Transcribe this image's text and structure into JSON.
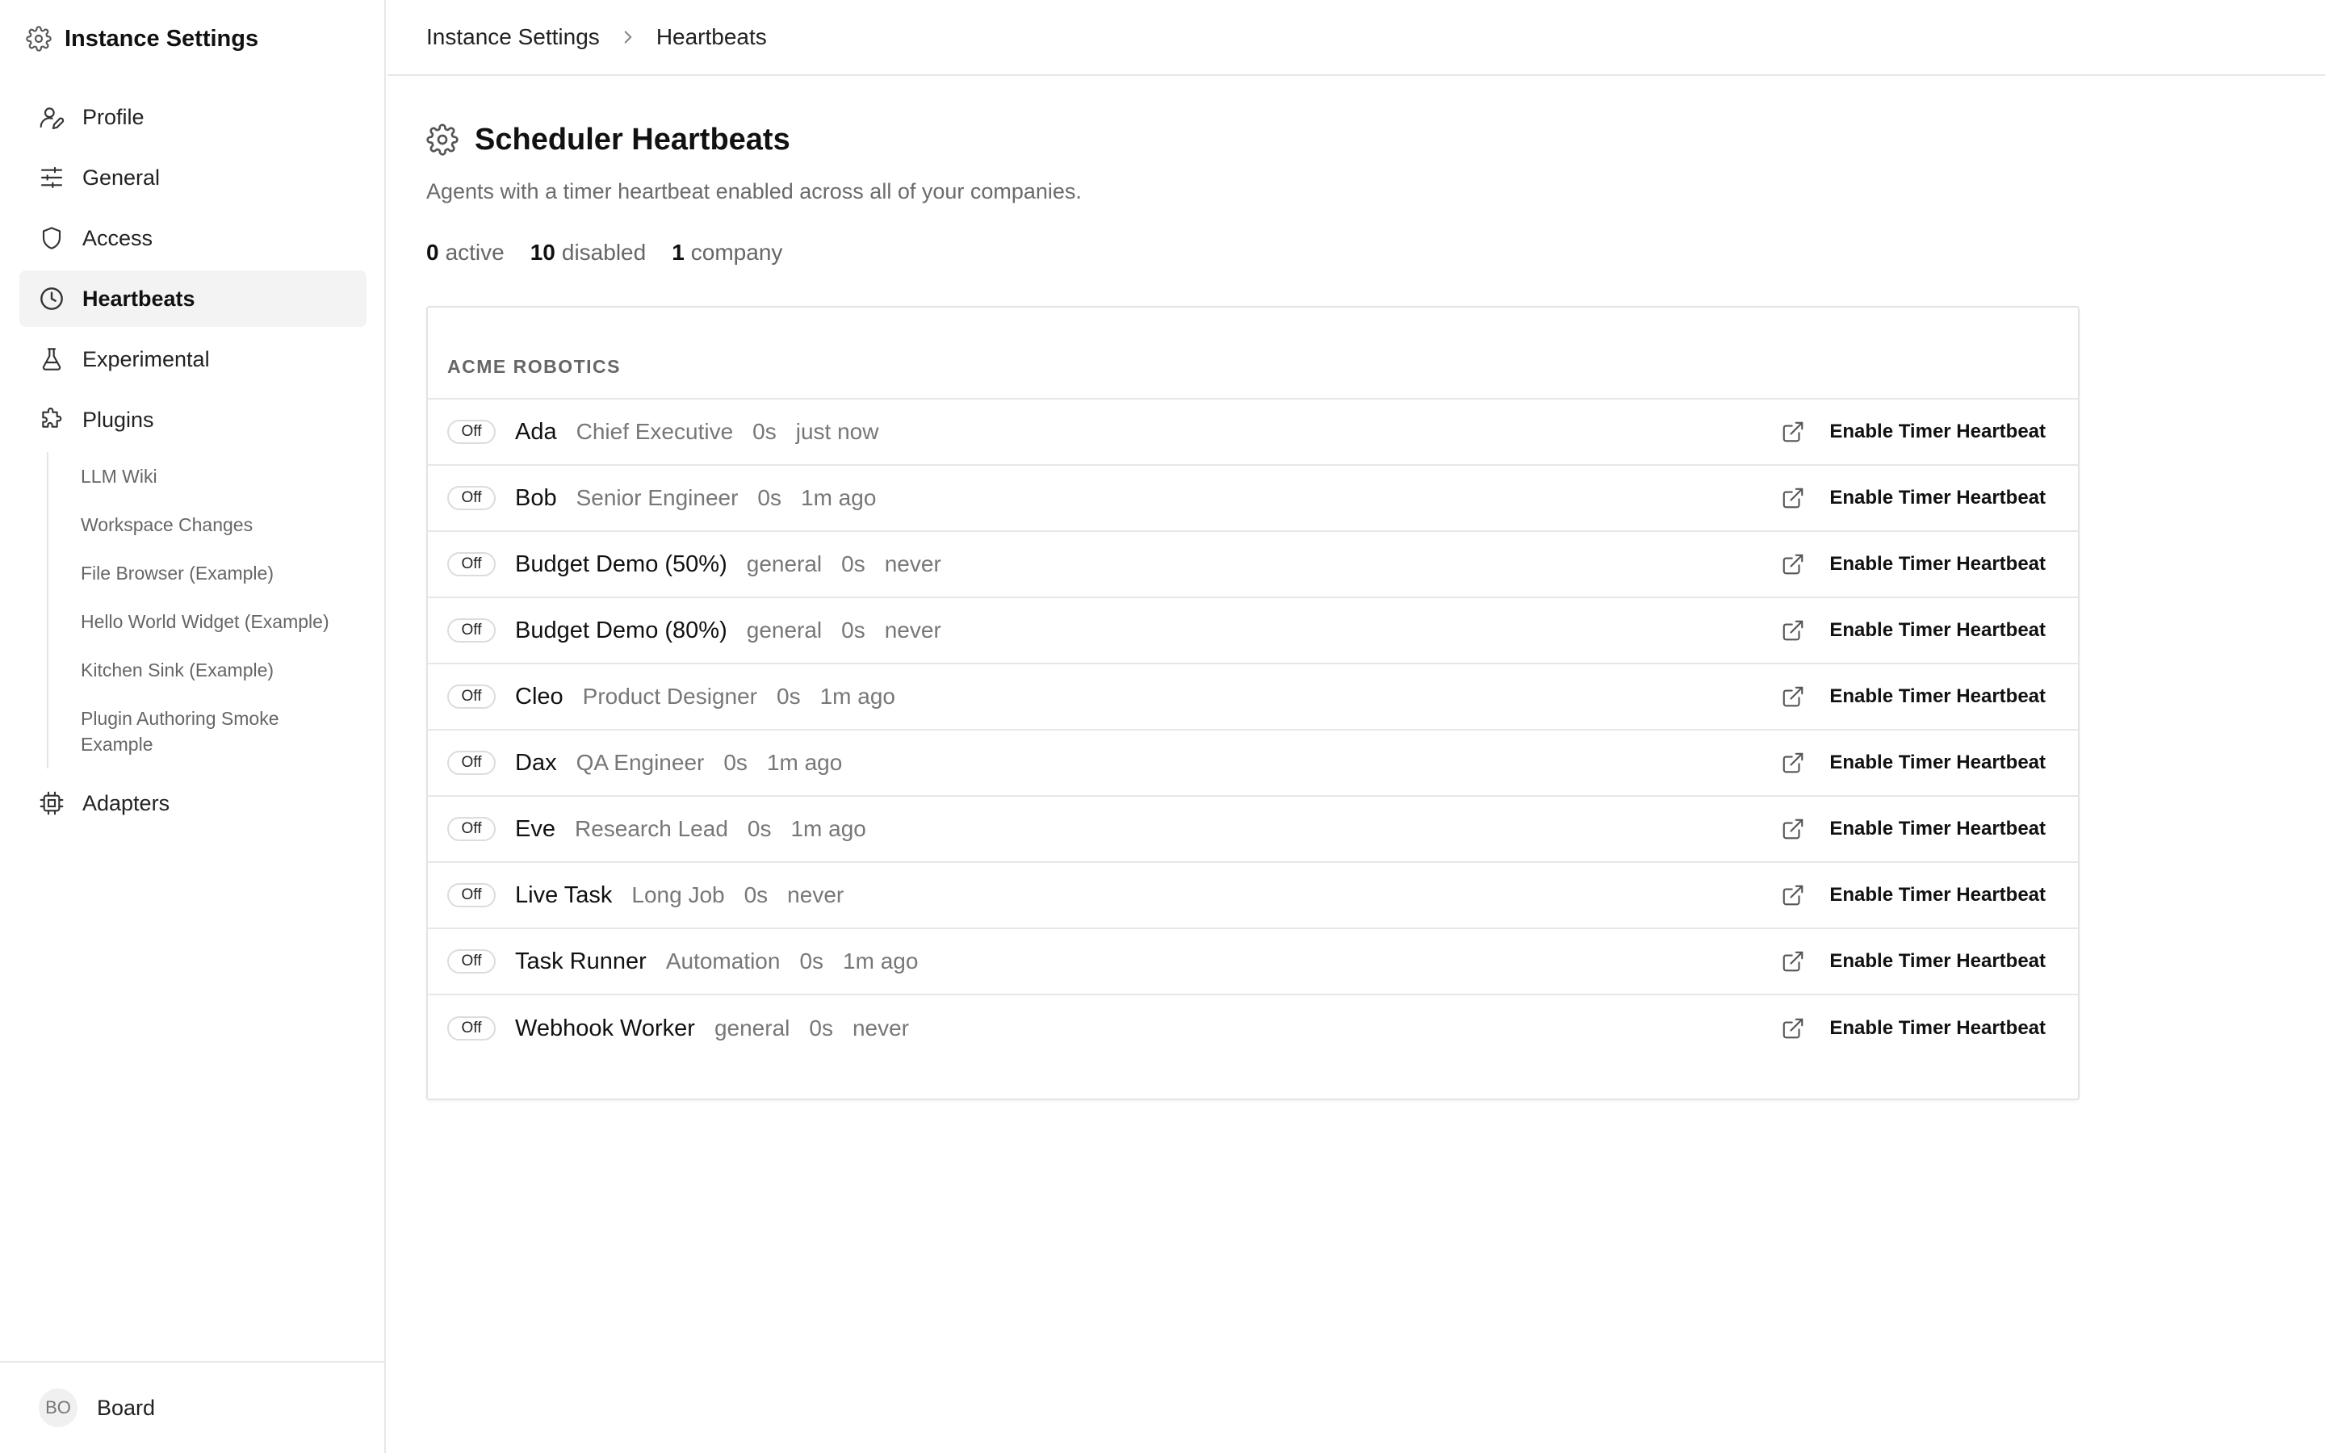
{
  "sidebar": {
    "title": "Instance Settings",
    "title_icon": "gear-icon",
    "items": [
      {
        "label": "Profile",
        "icon": "user-edit-icon"
      },
      {
        "label": "General",
        "icon": "sliders-icon"
      },
      {
        "label": "Access",
        "icon": "shield-icon"
      },
      {
        "label": "Heartbeats",
        "icon": "clock-icon",
        "active": true
      },
      {
        "label": "Experimental",
        "icon": "flask-icon"
      },
      {
        "label": "Plugins",
        "icon": "puzzle-icon"
      },
      {
        "label": "Adapters",
        "icon": "chip-icon"
      }
    ],
    "plugins": [
      "LLM Wiki",
      "Workspace Changes",
      "File Browser (Example)",
      "Hello World Widget (Example)",
      "Kitchen Sink (Example)",
      "Plugin Authoring Smoke Example"
    ],
    "footer": {
      "initials": "BO",
      "name": "Board"
    }
  },
  "breadcrumb": {
    "parent": "Instance Settings",
    "current": "Heartbeats"
  },
  "page": {
    "title": "Scheduler Heartbeats",
    "description": "Agents with a timer heartbeat enabled across all of your companies."
  },
  "stats": {
    "active_count": "0",
    "active_label": "active",
    "disabled_count": "10",
    "disabled_label": "disabled",
    "company_count": "1",
    "company_label": "company"
  },
  "company": {
    "name": "ACME ROBOTICS",
    "action_label": "Enable Timer Heartbeat",
    "agents": [
      {
        "status": "Off",
        "name": "Ada",
        "role": "Chief Executive",
        "interval": "0s",
        "last": "just now"
      },
      {
        "status": "Off",
        "name": "Bob",
        "role": "Senior Engineer",
        "interval": "0s",
        "last": "1m ago"
      },
      {
        "status": "Off",
        "name": "Budget Demo (50%)",
        "role": "general",
        "interval": "0s",
        "last": "never"
      },
      {
        "status": "Off",
        "name": "Budget Demo (80%)",
        "role": "general",
        "interval": "0s",
        "last": "never"
      },
      {
        "status": "Off",
        "name": "Cleo",
        "role": "Product Designer",
        "interval": "0s",
        "last": "1m ago"
      },
      {
        "status": "Off",
        "name": "Dax",
        "role": "QA Engineer",
        "interval": "0s",
        "last": "1m ago"
      },
      {
        "status": "Off",
        "name": "Eve",
        "role": "Research Lead",
        "interval": "0s",
        "last": "1m ago"
      },
      {
        "status": "Off",
        "name": "Live Task",
        "role": "Long Job",
        "interval": "0s",
        "last": "never"
      },
      {
        "status": "Off",
        "name": "Task Runner",
        "role": "Automation",
        "interval": "0s",
        "last": "1m ago"
      },
      {
        "status": "Off",
        "name": "Webhook Worker",
        "role": "general",
        "interval": "0s",
        "last": "never"
      }
    ]
  }
}
